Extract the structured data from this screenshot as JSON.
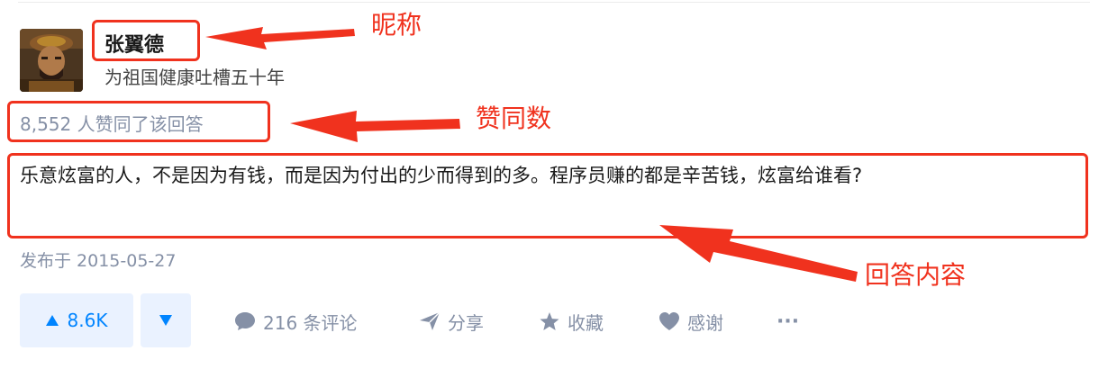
{
  "answer": {
    "author": {
      "name": "张翼德",
      "bio": "为祖国健康吐槽五十年"
    },
    "vote_count_text": "8,552 人赞同了该回答",
    "content": "乐意炫富的人，不是因为有钱，而是因为付出的少而得到的多。程序员赚的都是辛苦钱，炫富给谁看?",
    "publish_date": "发布于 2015-05-27"
  },
  "actions": {
    "upvote_label": "8.6K",
    "comments_label": "216 条评论",
    "share_label": "分享",
    "favorite_label": "收藏",
    "thanks_label": "感谢",
    "more_label": "···"
  },
  "annotations": {
    "nickname": "昵称",
    "vote_count": "赞同数",
    "answer_content": "回答内容"
  },
  "colors": {
    "accent": "#0084ff",
    "muted": "#8590a6",
    "annotation": "#f0321e",
    "vote_bg": "#eaf2ff"
  },
  "icons": [
    "upvote-triangle-icon",
    "downvote-triangle-icon",
    "comment-bubble-icon",
    "share-paper-plane-icon",
    "star-icon",
    "heart-icon",
    "more-dots-icon"
  ]
}
